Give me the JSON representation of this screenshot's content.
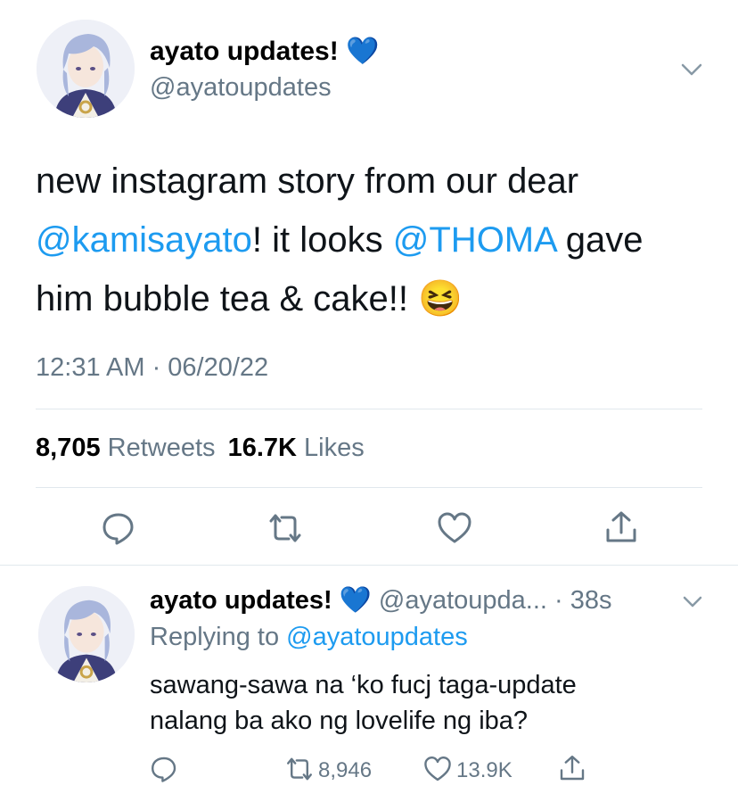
{
  "main_tweet": {
    "display_name": "ayato updates!",
    "verified_emoji": "💙",
    "handle": "@ayatoupdates",
    "text": {
      "line1": "new instagram story from our dear",
      "mention1": "@kamisayato",
      "part2": "! it looks ",
      "mention2": "@THOMA",
      "part3": " gave",
      "line3": "him bubble tea & cake!! ",
      "emoji": "😆"
    },
    "timestamp": "12:31 AM · 06/20/22",
    "stats": {
      "retweets_count": "8,705",
      "retweets_label": "Retweets",
      "likes_count": "16.7K",
      "likes_label": "Likes"
    },
    "actions": {
      "reply_icon": "reply-icon",
      "retweet_icon": "retweet-icon",
      "like_icon": "heart-icon",
      "share_icon": "share-icon"
    }
  },
  "reply_tweet": {
    "display_name": "ayato updates!",
    "verified_emoji": "💙",
    "handle": "@ayatoupda...",
    "time": "· 38s",
    "replying_label": "Replying to",
    "replying_handle": "@ayatoupdates",
    "text_line1": "sawang-sawa na ‘ko fucj taga-update",
    "text_line2": "nalang ba ako ng lovelife ng iba?",
    "retweet_count": "8,946",
    "like_count": "13.9K"
  },
  "colors": {
    "link": "#1d9bf0",
    "muted": "#657786",
    "divider": "#e1e8ed",
    "avatar_hair": "#a9b6dc",
    "avatar_coat": "#3d3f7a"
  }
}
